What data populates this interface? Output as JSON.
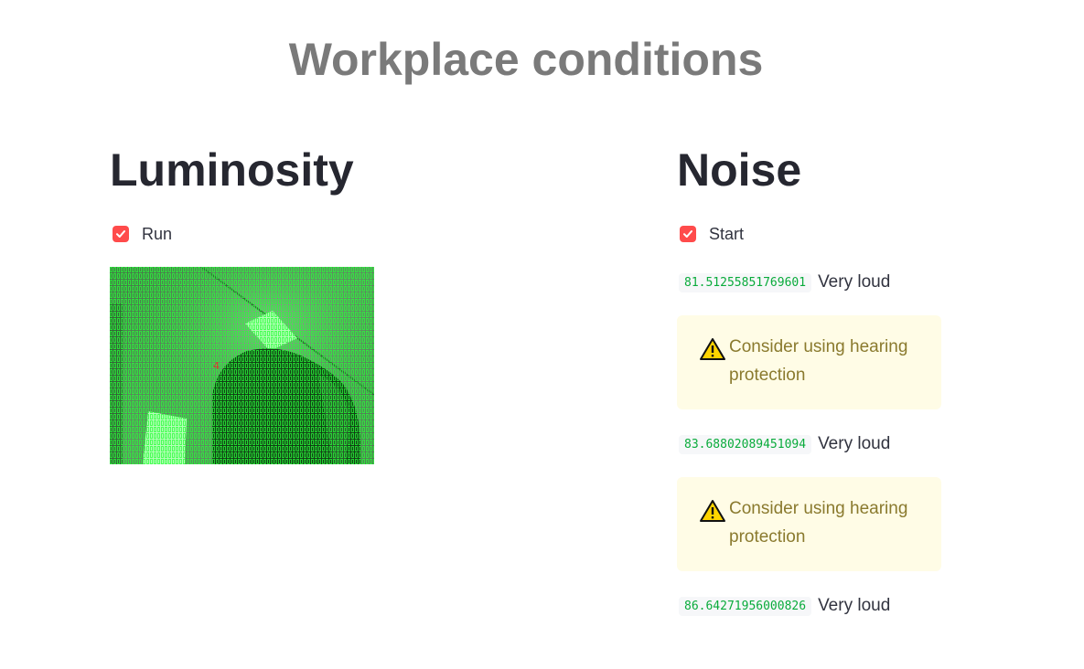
{
  "title": "Workplace conditions",
  "luminosity": {
    "heading": "Luminosity",
    "run_checkbox": {
      "label": "Run",
      "checked": true
    },
    "camera_overlay_marker": "4"
  },
  "noise": {
    "heading": "Noise",
    "start_checkbox": {
      "label": "Start",
      "checked": true
    },
    "readings": [
      {
        "value": "81.51255851769601",
        "status": "Very loud"
      },
      {
        "value": "83.68802089451094",
        "status": "Very loud"
      },
      {
        "value": "86.64271956000826",
        "status": "Very loud"
      }
    ],
    "warnings": [
      {
        "text": "Consider using hearing protection"
      },
      {
        "text": "Consider using hearing protection"
      }
    ]
  },
  "colors": {
    "accent": "#ff4b4b",
    "value_green": "#09ab3b",
    "warning_bg": "#fffce6",
    "warning_text": "#8a7a2e",
    "overlay_green": "#2bff3c"
  }
}
